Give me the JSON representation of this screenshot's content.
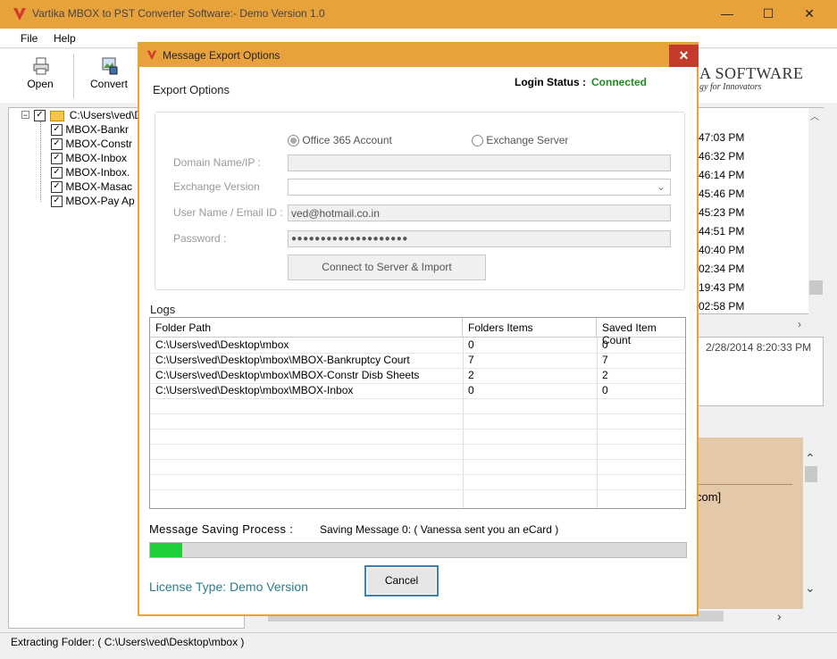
{
  "window": {
    "title": "Vartika MBOX to PST Converter Software:- Demo Version 1.0",
    "minimize": "—",
    "maximize": "☐",
    "close": "✕"
  },
  "menu": {
    "file": "File",
    "help": "Help"
  },
  "toolbar": {
    "open": "Open",
    "convert": "Convert"
  },
  "brand": {
    "name": "A SOFTWARE",
    "tagline": "gy for Innovators"
  },
  "tree": {
    "root": "C:\\Users\\ved\\De",
    "items": [
      "MBOX-Bankr",
      "MBOX-Constr",
      "MBOX-Inbox",
      "MBOX-Inbox.",
      "MBOX-Masac",
      "MBOX-Pay Ap"
    ]
  },
  "right_panel": {
    "times": [
      "47:03 PM",
      "46:32 PM",
      "46:14 PM",
      "45:46 PM",
      "45:23 PM",
      "44:51 PM",
      "40:40 PM",
      "02:34 PM",
      "19:43 PM",
      "02:58 PM"
    ],
    "detail_date": "2/28/2014 8:20:33 PM",
    "preview_text": "com]"
  },
  "status_bar": {
    "text": "Extracting Folder: ( C:\\Users\\ved\\Desktop\\mbox )"
  },
  "dialog": {
    "title": "Message Export Options",
    "close": "✕",
    "export_options": "Export Options",
    "login_status_label": "Login Status :",
    "login_status_value": "Connected",
    "radio_office365": "Office 365 Account",
    "radio_exchange": "Exchange Server",
    "domain_label": "Domain Name/IP :",
    "domain_value": "",
    "exchange_version_label": "Exchange Version",
    "exchange_version_value": "",
    "user_label": "User Name / Email ID :",
    "user_value": "ved@hotmail.co.in",
    "password_label": "Password :",
    "password_value": "●●●●●●●●●●●●●●●●●●●●",
    "connect_button": "Connect to Server & Import",
    "logs_title": "Logs",
    "logs_headers": [
      "Folder Path",
      "Folders Items",
      "Saved Item Count"
    ],
    "logs_rows": [
      [
        "C:\\Users\\ved\\Desktop\\mbox",
        "0",
        "0"
      ],
      [
        "C:\\Users\\ved\\Desktop\\mbox\\MBOX-Bankruptcy Court",
        "7",
        "7"
      ],
      [
        "C:\\Users\\ved\\Desktop\\mbox\\MBOX-Constr Disb Sheets",
        "2",
        "2"
      ],
      [
        "C:\\Users\\ved\\Desktop\\mbox\\MBOX-Inbox",
        "0",
        "0"
      ]
    ],
    "saving_label": "Message Saving Process :",
    "saving_status": "Saving Message 0: ( Vanessa sent you an eCard )",
    "progress_percent": 6,
    "cancel_button": "Cancel",
    "license": "License Type: Demo Version"
  },
  "colors": {
    "accent": "#e8a23c",
    "connected": "#1e8c1e",
    "progress": "#1fcf3a",
    "close": "#c43a2b"
  }
}
